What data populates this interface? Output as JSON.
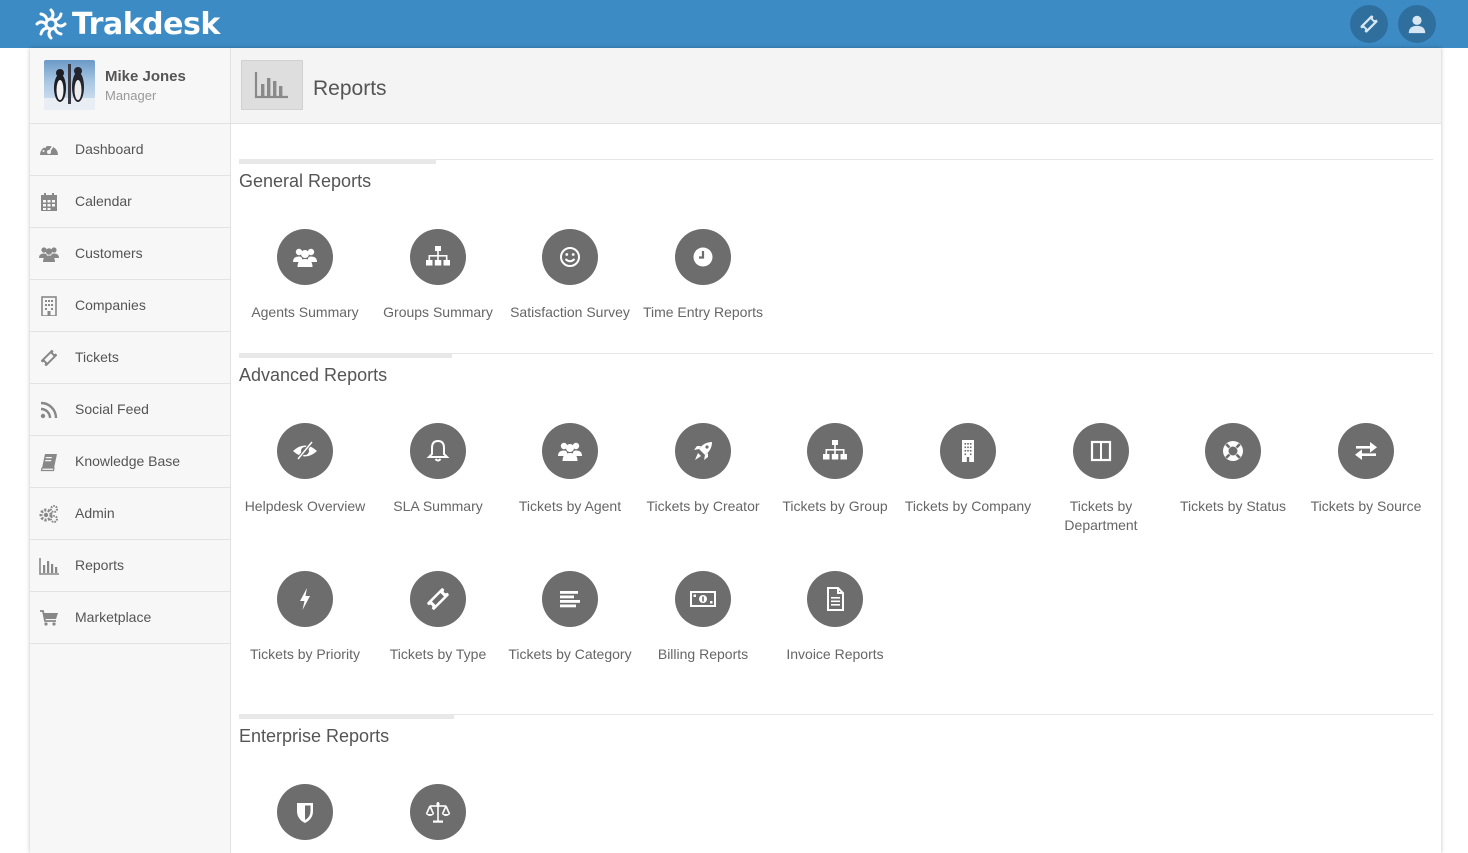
{
  "app": {
    "logo_text": "Trakdesk"
  },
  "topbar": {
    "ticket_icon": "ticket-icon",
    "user_icon": "user-icon"
  },
  "profile": {
    "name": "Mike Jones",
    "role": "Manager"
  },
  "sidebar": {
    "items": [
      {
        "label": "Dashboard",
        "icon": "dashboard-icon"
      },
      {
        "label": "Calendar",
        "icon": "calendar-icon"
      },
      {
        "label": "Customers",
        "icon": "users-icon"
      },
      {
        "label": "Companies",
        "icon": "building-icon"
      },
      {
        "label": "Tickets",
        "icon": "ticket-icon"
      },
      {
        "label": "Social Feed",
        "icon": "rss-icon"
      },
      {
        "label": "Knowledge Base",
        "icon": "book-icon"
      },
      {
        "label": "Admin",
        "icon": "gears-icon"
      },
      {
        "label": "Reports",
        "icon": "bar-chart-icon"
      },
      {
        "label": "Marketplace",
        "icon": "cart-icon"
      }
    ]
  },
  "header": {
    "title": "Reports",
    "icon": "bar-chart-icon"
  },
  "sections": {
    "general": {
      "title": "General Reports",
      "items": [
        {
          "label": "Agents Summary",
          "icon": "users-icon"
        },
        {
          "label": "Groups Summary",
          "icon": "sitemap-icon"
        },
        {
          "label": "Satisfaction Survey",
          "icon": "smile-icon"
        },
        {
          "label": "Time Entry Reports",
          "icon": "clock-icon"
        }
      ]
    },
    "advanced": {
      "title": "Advanced Reports",
      "items": [
        {
          "label": "Helpdesk Overview",
          "icon": "eye-slash-icon"
        },
        {
          "label": "SLA Summary",
          "icon": "bell-icon"
        },
        {
          "label": "Tickets by Agent",
          "icon": "users-icon"
        },
        {
          "label": "Tickets by Creator",
          "icon": "rocket-icon"
        },
        {
          "label": "Tickets by Group",
          "icon": "sitemap-icon"
        },
        {
          "label": "Tickets by Company",
          "icon": "building-icon"
        },
        {
          "label": "Tickets by Department",
          "icon": "columns-icon"
        },
        {
          "label": "Tickets by Status",
          "icon": "life-ring-icon"
        },
        {
          "label": "Tickets by Source",
          "icon": "exchange-icon"
        },
        {
          "label": "Tickets by Priority",
          "icon": "bolt-icon"
        },
        {
          "label": "Tickets by Type",
          "icon": "ticket-icon"
        },
        {
          "label": "Tickets by Category",
          "icon": "align-left-icon"
        },
        {
          "label": "Billing Reports",
          "icon": "money-icon"
        },
        {
          "label": "Invoice Reports",
          "icon": "file-text-icon"
        }
      ]
    },
    "enterprise": {
      "title": "Enterprise Reports",
      "items": [
        {
          "label": "",
          "icon": "shield-icon"
        },
        {
          "label": "",
          "icon": "balance-scale-icon"
        }
      ]
    }
  },
  "colors": {
    "topbar": "#3d8bc4",
    "icon_circle": "#6d6d6d",
    "sidebar_bg": "#f7f7f7"
  }
}
